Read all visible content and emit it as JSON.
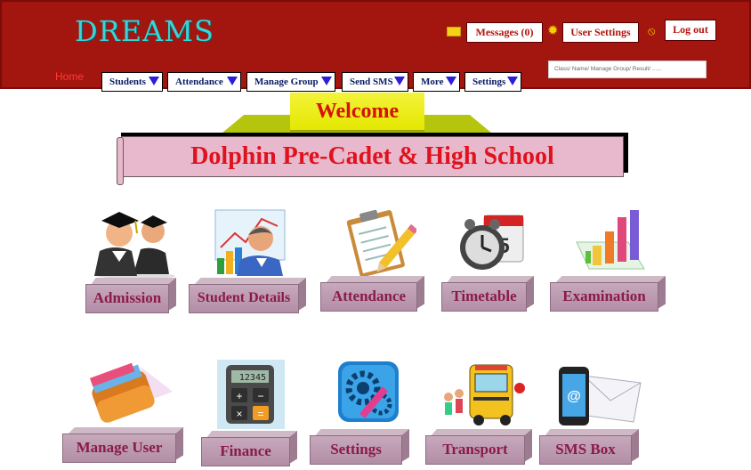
{
  "app": {
    "logo": "DREAMS"
  },
  "header": {
    "messages_label": "Messages (0)",
    "user_settings_label": "User Settings",
    "logout_label": "Log out",
    "home_label": "Home",
    "search_placeholder": "Class/ Name/ Manage Group/ Result/ ......"
  },
  "nav": [
    {
      "label": "Students"
    },
    {
      "label": "Attendance"
    },
    {
      "label": "Manage Group"
    },
    {
      "label": "Send SMS"
    },
    {
      "label": "More"
    },
    {
      "label": "Settings"
    }
  ],
  "banner": {
    "welcome": "Welcome",
    "school_name": "Dolphin Pre-Cadet & High School"
  },
  "tiles": [
    {
      "label": "Admission",
      "icon": "graduates-icon"
    },
    {
      "label": "Student Details",
      "icon": "businessman-chart-icon"
    },
    {
      "label": "Attendance",
      "icon": "clipboard-pencil-icon"
    },
    {
      "label": "Timetable",
      "icon": "clock-calendar-icon"
    },
    {
      "label": "Examination",
      "icon": "bar-chart-icon"
    },
    {
      "label": "Manage User",
      "icon": "wallet-icon"
    },
    {
      "label": "Finance",
      "icon": "calculator-icon"
    },
    {
      "label": "Settings",
      "icon": "settings-gears-icon"
    },
    {
      "label": "Transport",
      "icon": "school-bus-icon"
    },
    {
      "label": "SMS Box",
      "icon": "phone-envelope-icon"
    }
  ],
  "colors": {
    "header_bg": "#a3150f",
    "logo": "#37d6d6",
    "welcome_bg": "#e4e800",
    "scroll_bg": "#e8b9cc",
    "tile_plate": "#c7a8bc",
    "tile_text": "#8b1a4a"
  }
}
